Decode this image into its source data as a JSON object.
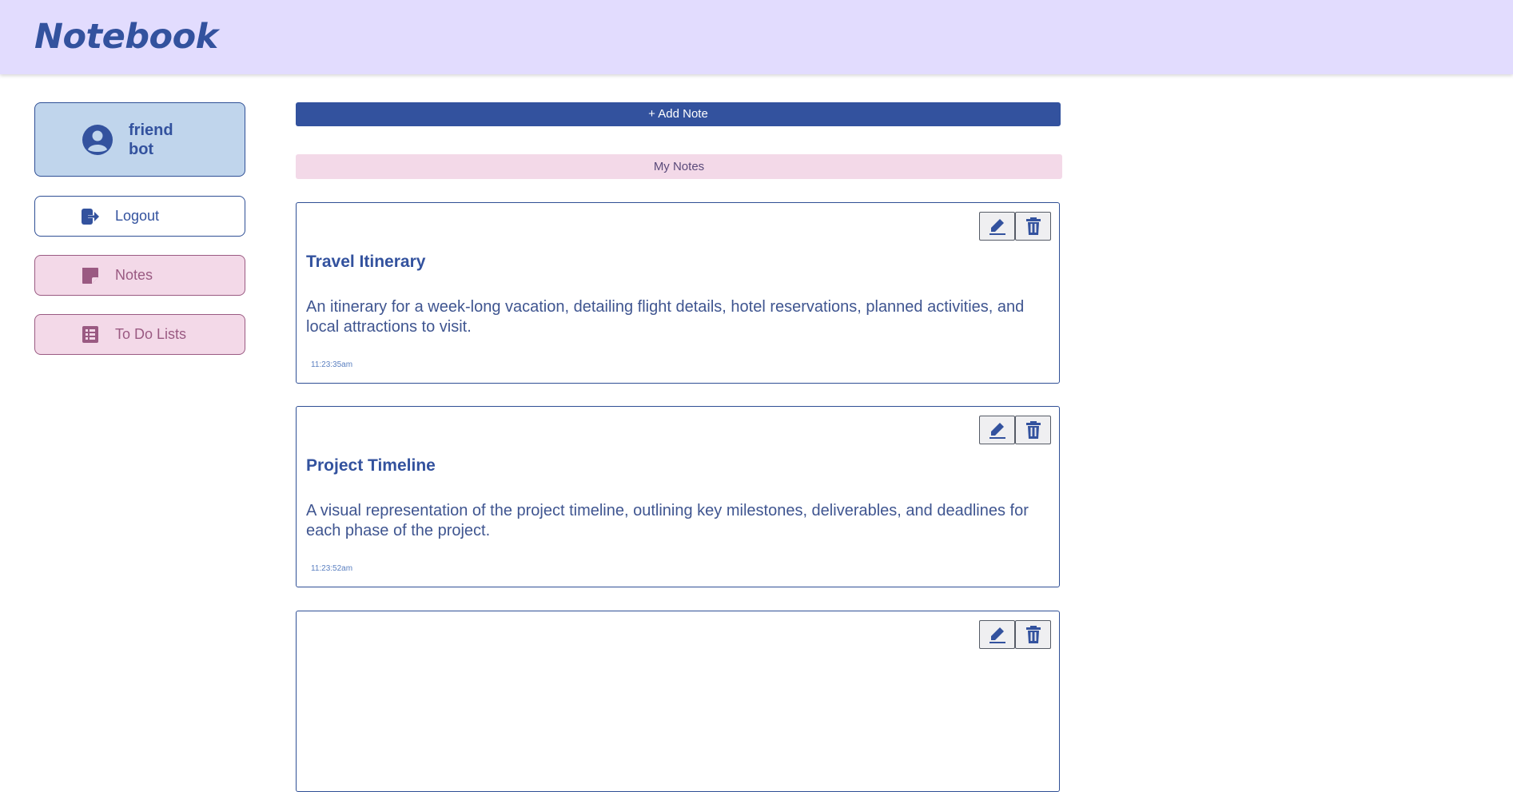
{
  "app": {
    "title": "Notebook"
  },
  "profile": {
    "name": "friend\nbot",
    "icon": "user-circle-icon"
  },
  "nav": {
    "logout": {
      "label": "Logout",
      "icon": "logout-icon"
    },
    "notes": {
      "label": "Notes",
      "icon": "sticky-note-icon"
    },
    "todo": {
      "label": "To Do Lists",
      "icon": "list-icon"
    }
  },
  "main": {
    "add_note_label": "+ Add Note",
    "section_label": "My Notes"
  },
  "notes": [
    {
      "title": "Travel Itinerary",
      "body": "An itinerary for a week-long vacation, detailing flight details, hotel reservations, planned activities, and local attractions to visit.",
      "time": "11:23:35am"
    },
    {
      "title": "Project Timeline",
      "body": "A visual representation of the project timeline, outlining key milestones, deliverables, and deadlines for each phase of the project.",
      "time": "11:23:52am"
    },
    {
      "title": "",
      "body": "",
      "time": ""
    }
  ],
  "colors": {
    "header_bg": "#e2dcfe",
    "brand": "#33529e",
    "profile_bg": "#c0d5ec",
    "pink_bg": "#f3d9e8",
    "pink_text": "#9a5a82"
  }
}
